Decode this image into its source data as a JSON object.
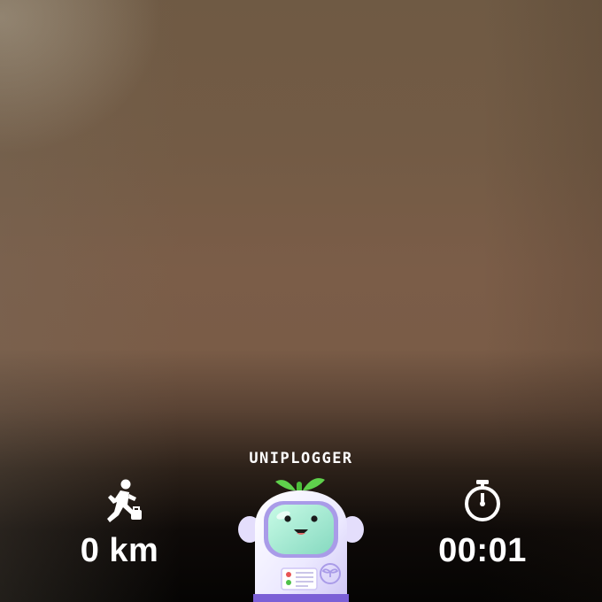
{
  "screen": {
    "brand_label": "UNIPLOGGER"
  },
  "stats": {
    "distance": {
      "icon": "running-with-bag-icon",
      "value": "0 km"
    },
    "time": {
      "icon": "stopwatch-icon",
      "value": "00:01"
    }
  },
  "mascot": {
    "icon": "robot-mascot-icon",
    "colors": {
      "body": "#ece9ff",
      "visor": "#a8f0d4",
      "sprout": "#5fd14c",
      "base": "#7b5fd6"
    }
  }
}
